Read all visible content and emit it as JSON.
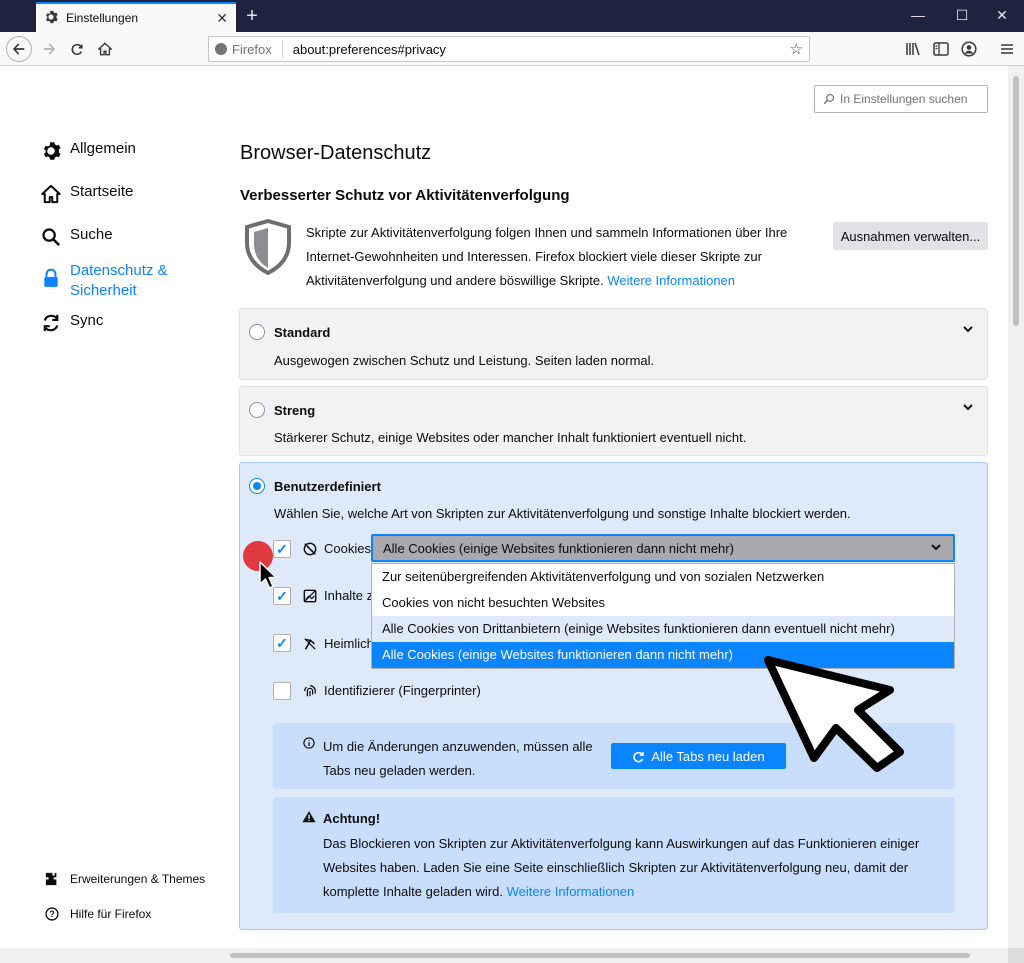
{
  "browser": {
    "tab_title": "Einstellungen",
    "identity_label": "Firefox",
    "url": "about:preferences#privacy"
  },
  "search": {
    "placeholder": "In Einstellungen suchen"
  },
  "sidebar": {
    "items": [
      {
        "label": "Allgemein",
        "icon": "gear-icon"
      },
      {
        "label": "Startseite",
        "icon": "home-icon"
      },
      {
        "label": "Suche",
        "icon": "search-icon"
      },
      {
        "label": "Datenschutz & Sicherheit",
        "icon": "lock-icon",
        "active": true
      },
      {
        "label": "Sync",
        "icon": "sync-icon"
      }
    ],
    "footer": [
      {
        "label": "Erweiterungen & Themes",
        "icon": "puzzle-icon"
      },
      {
        "label": "Hilfe für Firefox",
        "icon": "help-icon"
      }
    ]
  },
  "main": {
    "section_title": "Browser-Datenschutz",
    "etp_heading": "Verbesserter Schutz vor Aktivitätenverfolgung",
    "etp_desc": "Skripte zur Aktivitätenverfolgung folgen Ihnen und sammeln Informationen über Ihre Internet-Gewohnheiten und Interessen. Firefox blockiert viele dieser Skripte zur Aktivitätenverfolgung und andere böswillige Skripte.",
    "etp_link": "Weitere Informationen",
    "exceptions_button": "Ausnahmen verwalten...",
    "standard": {
      "title": "Standard",
      "desc": "Ausgewogen zwischen Schutz und Leistung. Seiten laden normal."
    },
    "strict": {
      "title": "Streng",
      "desc": "Stärkerer Schutz, einige Websites oder mancher Inhalt funktioniert eventuell nicht."
    },
    "custom": {
      "title": "Benutzerdefiniert",
      "desc": "Wählen Sie, welche Art von Skripten zur Aktivitätenverfolgung und sonstige Inhalte blockiert werden.",
      "options": [
        {
          "label": "Cookies",
          "checked": true,
          "icon": "cookie-icon"
        },
        {
          "label": "Inhalte z",
          "checked": true,
          "icon": "tracking-content-icon"
        },
        {
          "label": "Heimlich",
          "checked": true,
          "icon": "cryptominer-icon"
        },
        {
          "label": "Identifizierer (Fingerprinter)",
          "checked": false,
          "icon": "fingerprint-icon"
        }
      ],
      "cookie_select_value": "Alle Cookies (einige Websites funktionieren dann nicht mehr)",
      "cookie_options": [
        "Zur seitenübergreifenden Aktivitätenverfolgung und von sozialen Netzwerken",
        "Cookies von nicht besuchten Websites",
        "Alle Cookies von Drittanbietern (einige Websites funktionieren dann eventuell nicht mehr)",
        "Alle Cookies (einige Websites funktionieren dann nicht mehr)"
      ],
      "reload_notice": "Um die Änderungen anzuwenden, müssen alle Tabs neu geladen werden.",
      "reload_button": "Alle Tabs neu laden",
      "warning_title": "Achtung!",
      "warning_text": "Das Blockieren von Skripten zur Aktivitätenverfolgung kann Auswirkungen auf das Funktionieren einiger Websites haben. Laden Sie eine Seite einschließlich Skripten zur Aktivitätenverfolgung neu, damit der komplette Inhalte geladen wird.",
      "warning_link": "Weitere Informationen"
    }
  },
  "colors": {
    "accent": "#0a84ff",
    "custom_bg": "#deeafa",
    "notice_bg": "#c9ddfc"
  }
}
